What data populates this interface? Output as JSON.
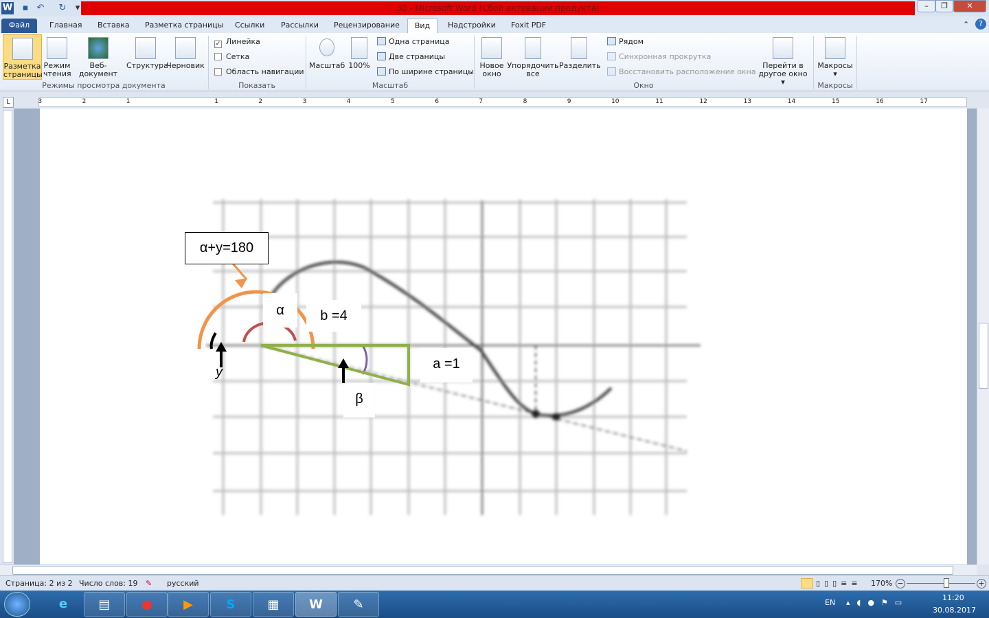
{
  "window": {
    "title": "30  -  Microsoft Word (Сбой активации продукта)"
  },
  "tabs": [
    "Файл",
    "Главная",
    "Вставка",
    "Разметка страницы",
    "Ссылки",
    "Рассылки",
    "Рецензирование",
    "Вид",
    "Надстройки",
    "Foxit PDF"
  ],
  "ribbon": {
    "views": {
      "items": [
        "Разметка страницы",
        "Режим чтения",
        "Веб-документ",
        "Структура",
        "Черновик"
      ],
      "label": "Режимы просмотра документа"
    },
    "show": {
      "ruler": "Линейка",
      "grid": "Сетка",
      "nav": "Область навигации",
      "label": "Показать",
      "ruler_checked": true
    },
    "zoom": {
      "zoom": "Масштаб",
      "hundred": "100%",
      "one_page": "Одна страница",
      "two_pages": "Две страницы",
      "page_width": "По ширине страницы",
      "label": "Масштаб"
    },
    "window": {
      "new": "Новое окно",
      "arrange": "Упорядочить все",
      "split": "Разделить",
      "side": "Рядом",
      "sync": "Синхронная прокрутка",
      "reset": "Восстановить расположение окна",
      "switch": "Перейти в другое окно",
      "label": "Окно"
    },
    "macros": {
      "macros": "Макросы",
      "label": "Макросы"
    }
  },
  "ruler": {
    "left": [
      "3",
      "2",
      "1"
    ],
    "right": [
      "1",
      "2",
      "3",
      "4",
      "5",
      "6",
      "7",
      "8",
      "9",
      "10",
      "11",
      "12",
      "13",
      "14",
      "15",
      "16",
      "17"
    ]
  },
  "diagram": {
    "sum": "α+y=180",
    "alpha": "α",
    "b": "b =4",
    "a": "a =1",
    "beta": "β",
    "gamma": "y"
  },
  "status": {
    "page": "Страница: 2 из 2",
    "words": "Число слов: 19",
    "lang": "русский",
    "zoom": "170%"
  },
  "taskbar": {
    "lang": "EN",
    "time": "11:20",
    "date": "30.08.2017"
  }
}
